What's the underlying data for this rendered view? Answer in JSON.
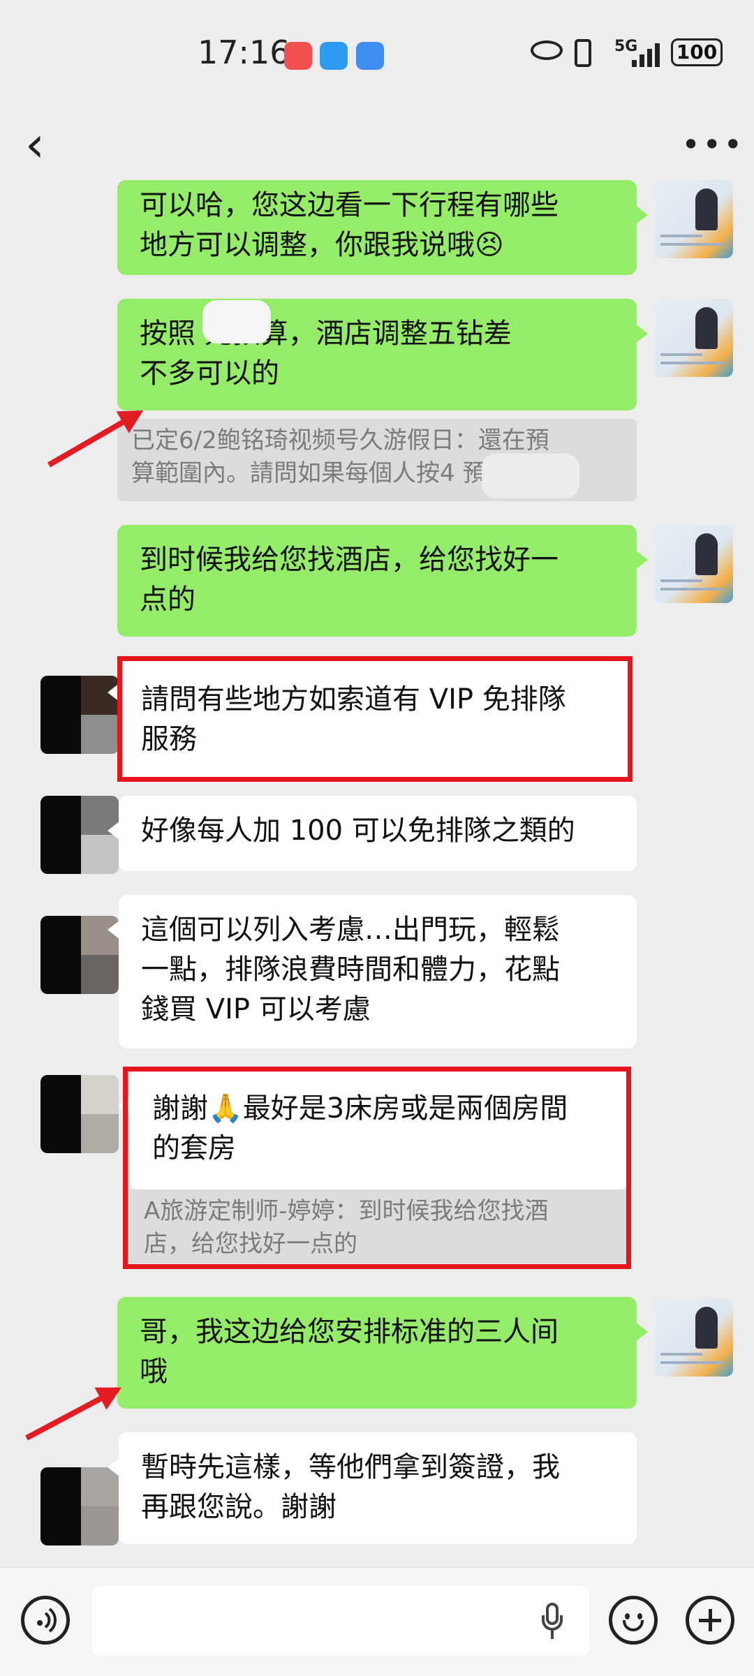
{
  "status_bar": {
    "time": "17:16",
    "signal": "5G",
    "battery": "100",
    "apps": [
      "huawei-app-icon",
      "message-app-icon",
      "weather-app-icon"
    ],
    "indicators": [
      "eye-icon",
      "vibrate-icon",
      "signal-bars-icon"
    ]
  },
  "nav": {
    "back_icon": "chevron-left-icon",
    "more_label": "•••"
  },
  "messages": [
    {
      "side": "me",
      "lines": [
        "可以哈，您这边看一下行程有哪些",
        "地方可以调整，你跟我说哦😣"
      ]
    },
    {
      "side": "me",
      "lines": [
        "按照       元预算，酒店调整五钻差",
        "不多可以的"
      ],
      "quote": [
        "已定6/2鲍铭琦视频号久游假日：還在預",
        "算範圍內。請問如果每個人按4      預..."
      ]
    },
    {
      "side": "me",
      "lines": [
        "到时候我给您找酒店，给您找好一",
        "点的"
      ]
    },
    {
      "side": "other",
      "lines": [
        "請問有些地方如索道有 VIP 免排隊",
        "服務"
      ]
    },
    {
      "side": "other",
      "lines": [
        "好像每人加 100 可以免排隊之類的"
      ]
    },
    {
      "side": "other",
      "lines": [
        "這個可以列入考慮…出門玩，輕鬆",
        "一點，排隊浪費時間和體力，花點",
        "錢買 VIP 可以考慮"
      ]
    },
    {
      "side": "other",
      "lines": [
        "謝謝🙏最好是3床房或是兩個房間",
        "的套房"
      ],
      "quote": [
        "A旅游定制师-婷婷：到时候我给您找酒",
        "店，给您找好一点的"
      ]
    },
    {
      "side": "me",
      "lines": [
        "哥，我这边给您安排标准的三人间",
        "哦"
      ]
    },
    {
      "side": "other",
      "lines": [
        "暫時先這樣，等他們拿到簽證，我",
        "再跟您說。謝謝"
      ]
    }
  ],
  "input_bar": {
    "voice_icon": "voice-mode-icon",
    "mic_icon": "microphone-icon",
    "emoji_icon": "emoji-icon",
    "plus_icon": "plus-icon"
  },
  "colors": {
    "my_bubble": "#95ec69",
    "other_bubble": "#ffffff",
    "highlight": "#e6141b",
    "background": "#ededed"
  }
}
